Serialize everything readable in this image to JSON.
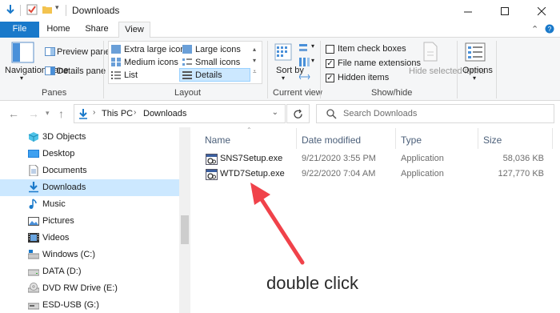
{
  "window": {
    "title": "Downloads",
    "controls": [
      "minimize",
      "maximize",
      "close"
    ]
  },
  "ribbon": {
    "tabs": [
      "File",
      "Home",
      "Share",
      "View"
    ],
    "active_tab": "View",
    "groups": {
      "panes": {
        "label": "Panes",
        "navigation_pane": "Navigation pane",
        "preview_pane": "Preview pane",
        "details_pane": "Details pane"
      },
      "layout": {
        "label": "Layout",
        "options": [
          "Extra large icons",
          "Large icons",
          "Medium icons",
          "Small icons",
          "List",
          "Details"
        ],
        "selected": "Details"
      },
      "current_view": {
        "label": "Current view",
        "sort_by": "Sort by"
      },
      "show_hide": {
        "label": "Show/hide",
        "item_check_boxes": {
          "label": "Item check boxes",
          "checked": false
        },
        "file_name_extensions": {
          "label": "File name extensions",
          "checked": true
        },
        "hidden_items": {
          "label": "Hidden items",
          "checked": true
        },
        "hide_selected": "Hide selected items"
      },
      "options": {
        "label": "Options"
      }
    }
  },
  "address": {
    "path": [
      "This PC",
      "Downloads"
    ],
    "search_placeholder": "Search Downloads"
  },
  "sidebar": {
    "items": [
      {
        "label": "3D Objects",
        "icon": "3d-objects-icon"
      },
      {
        "label": "Desktop",
        "icon": "desktop-icon"
      },
      {
        "label": "Documents",
        "icon": "documents-icon"
      },
      {
        "label": "Downloads",
        "icon": "downloads-icon",
        "selected": true
      },
      {
        "label": "Music",
        "icon": "music-icon"
      },
      {
        "label": "Pictures",
        "icon": "pictures-icon"
      },
      {
        "label": "Videos",
        "icon": "videos-icon"
      },
      {
        "label": "Windows (C:)",
        "icon": "drive-icon"
      },
      {
        "label": "DATA (D:)",
        "icon": "drive-icon"
      },
      {
        "label": "DVD RW Drive (E:)",
        "icon": "dvd-drive-icon"
      },
      {
        "label": "ESD-USB (G:)",
        "icon": "usb-drive-icon"
      }
    ]
  },
  "files": {
    "columns": [
      "Name",
      "Date modified",
      "Type",
      "Size"
    ],
    "rows": [
      {
        "name": "SNS7Setup.exe",
        "date": "9/21/2020 3:55 PM",
        "type": "Application",
        "size": "58,036 KB"
      },
      {
        "name": "WTD7Setup.exe",
        "date": "9/22/2020 7:04 AM",
        "type": "Application",
        "size": "127,770 KB"
      }
    ]
  },
  "annotation": {
    "text": "double click",
    "arrow_color": "#f0424a"
  },
  "colors": {
    "accent": "#1979ca",
    "selection": "#cce8ff"
  }
}
